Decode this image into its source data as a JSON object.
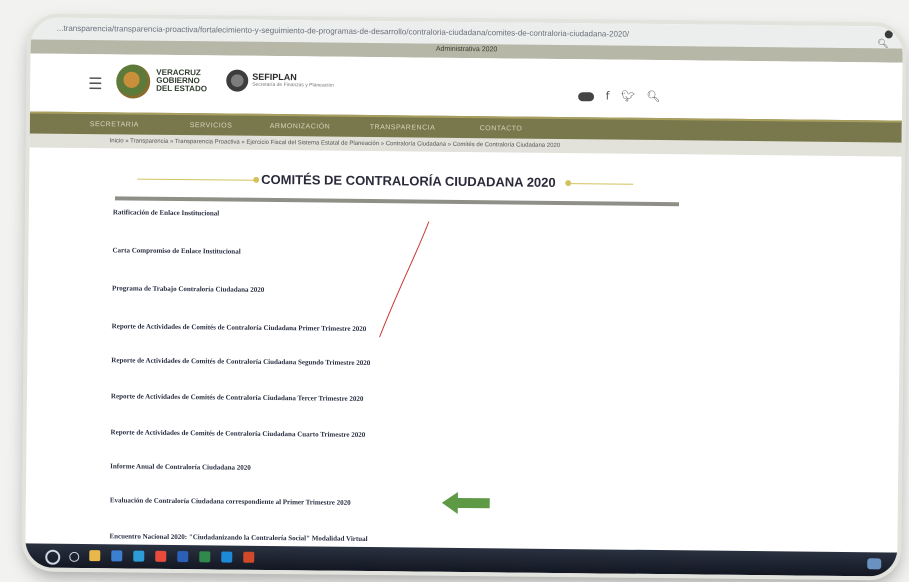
{
  "browser": {
    "url": "...transparencia/transparencia-proactiva/fortalecimiento-y-seguimiento-de-programas-de-desarrollo/contraloria-ciudadana/comites-de-contraloria-ciudadana-2020/",
    "subtitle": "Administrativa 2020",
    "zoom_icon": "zoom-icon"
  },
  "header": {
    "logo1": "VERACRUZ GOBIERNO DEL ESTADO",
    "logo2": "SEFIPLAN",
    "logo2_sub": "Secretaría de Finanzas y Planeación",
    "icons": [
      "accessibility-icon",
      "facebook-icon",
      "twitter-icon",
      "search-icon"
    ]
  },
  "nav": {
    "items": [
      "SECRETARIA",
      "SERVICIOS",
      "ARMONIZACIÓN",
      "TRANSPARENCIA",
      "CONTACTO"
    ]
  },
  "breadcrumb": "Inicio » Transparencia » Transparencia Proactiva » Ejercicio Fiscal del Sistema Estatal de Planeación » Contraloría Ciudadana » Comités de Contraloría Ciudadana 2020",
  "page": {
    "title": "COMITÉS DE CONTRALORÍA CIUDADANA 2020"
  },
  "documents": [
    "Ratificación de Enlace Institucional",
    "Carta Compromiso de Enlace Institucional",
    "Programa de Trabajo Contraloría Ciudadana 2020",
    "Reporte de Actividades de Comités de Contraloría Ciudadana Primer Trimestre 2020",
    "Reporte de Actividades de Comités de Contraloría Ciudadana Segundo Trimestre 2020",
    "Reporte de Actividades de Comités de Contraloría Ciudadana Tercer Trimestre 2020",
    "Reporte de Actividades de Comités de Contraloría Ciudadana Cuarto Trimestre 2020",
    "Informe Anual de Contraloría Ciudadana 2020",
    "Evaluación de Contraloría Ciudadana correspondiente al Primer Trimestre 2020",
    "Encuentro Nacional 2020: \"Ciudadanizando la Contraloría Social\" Modalidad Virtual"
  ],
  "colors": {
    "nav": "#79784d",
    "accent": "#d2c35c",
    "arrow": "#5e9a45",
    "link": "#2a2f42"
  },
  "taskbar": {
    "apps": [
      "file-explorer-icon",
      "mail-icon",
      "store-icon",
      "chrome-icon",
      "word-icon",
      "excel-icon",
      "edge-icon",
      "powerpoint-icon"
    ]
  }
}
